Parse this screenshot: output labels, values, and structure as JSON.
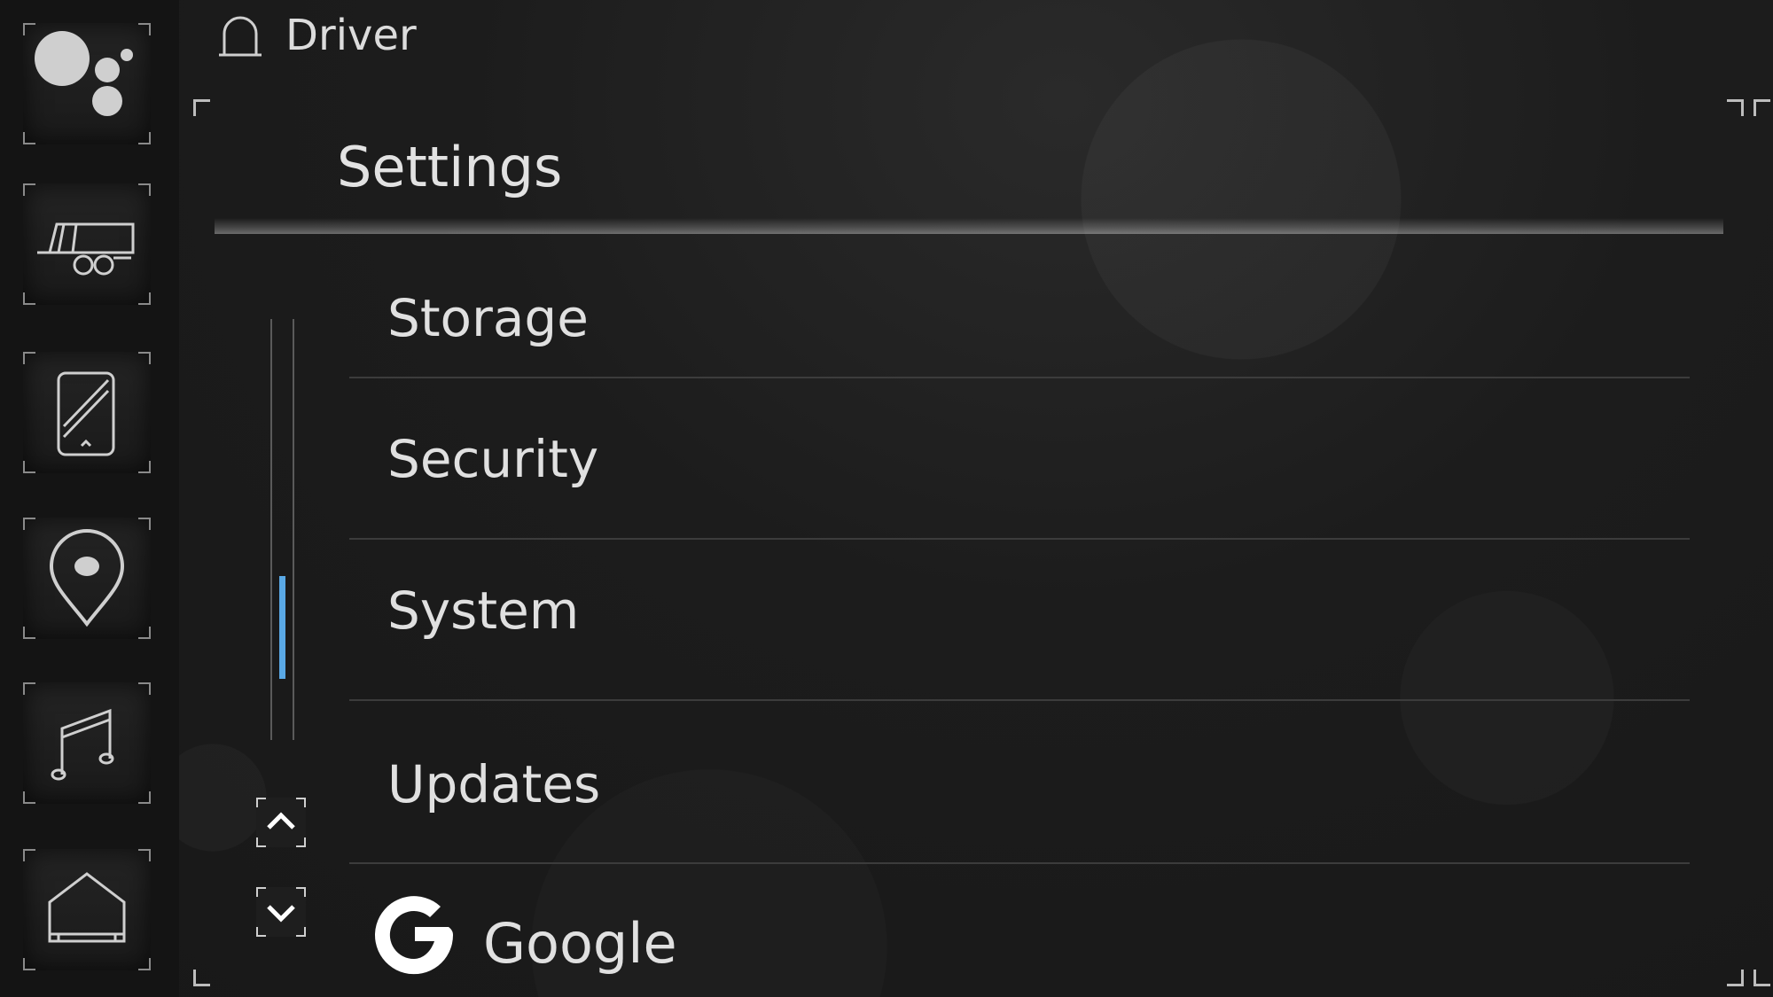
{
  "header": {
    "profile_name": "Driver",
    "profile_icon": "bell-icon"
  },
  "page": {
    "title": "Settings"
  },
  "sidebar": {
    "items": [
      {
        "name": "assistant",
        "icon": "assistant-dots-icon"
      },
      {
        "name": "trailer",
        "icon": "trailer-icon"
      },
      {
        "name": "phone",
        "icon": "phone-icon"
      },
      {
        "name": "navigation",
        "icon": "map-pin-icon"
      },
      {
        "name": "media",
        "icon": "music-note-icon"
      },
      {
        "name": "home",
        "icon": "home-icon"
      }
    ]
  },
  "list": {
    "items": [
      {
        "label": "Storage"
      },
      {
        "label": "Security"
      },
      {
        "label": "System"
      },
      {
        "label": "Updates"
      },
      {
        "label": "Google",
        "icon": "google-g-icon"
      }
    ]
  },
  "scroll": {
    "up_icon": "chevron-up-icon",
    "down_icon": "chevron-down-icon"
  },
  "colors": {
    "accent": "#5aa9e6",
    "background": "#1c1c1c",
    "text": "#e0e0e0"
  }
}
